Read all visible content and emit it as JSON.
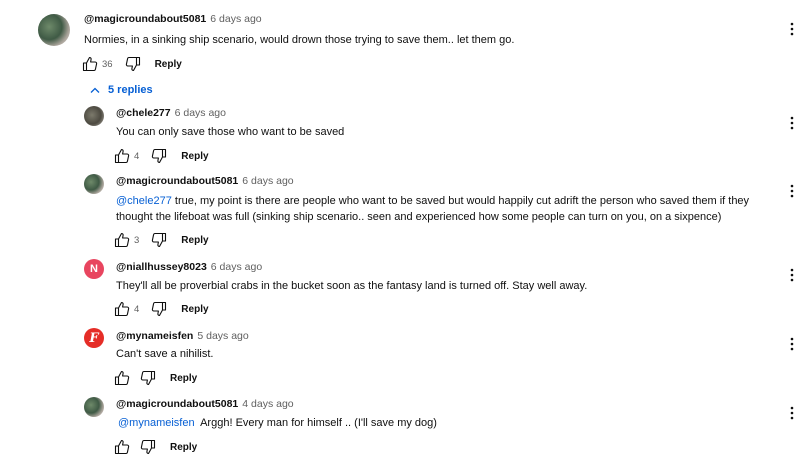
{
  "top_comment": {
    "author": "@magicroundabout5081",
    "time": "6 days ago",
    "text": "Normies, in a sinking ship scenario, would drown those trying to save them.. let them go.",
    "likes": "36",
    "reply_label": "Reply"
  },
  "replies_toggle": {
    "label": "5 replies"
  },
  "replies": [
    {
      "author": "@chele277",
      "time": "6 days ago",
      "mention": "",
      "text": "You can only save those who want to be saved",
      "likes": "4",
      "reply_label": "Reply"
    },
    {
      "author": "@magicroundabout5081",
      "time": "6 days ago",
      "mention": "@chele277",
      "text": " true, my point is there are people who want to be saved but would happily cut adrift the person who saved them if they thought the lifeboat was full (sinking ship scenario.. seen and experienced how some people can turn on you, on a sixpence)",
      "likes": "3",
      "reply_label": "Reply"
    },
    {
      "author": "@niallhussey8023",
      "time": "6 days ago",
      "avatar_letter": "N",
      "mention": "",
      "text": "They'll all be proverbial crabs in the bucket soon as the fantasy land is turned off. Stay well away.",
      "likes": "4",
      "reply_label": "Reply"
    },
    {
      "author": "@mynameisfen",
      "time": "5 days ago",
      "avatar_letter": "F",
      "mention": "",
      "text": "Can't save a nihilist.",
      "likes": "",
      "reply_label": "Reply"
    },
    {
      "author": "@magicroundabout5081",
      "time": "4 days ago",
      "mention": "@mynameisfen",
      "text": "  Arggh! Every man for himself .. (I'll save my dog)",
      "likes": "",
      "reply_label": "Reply"
    }
  ]
}
